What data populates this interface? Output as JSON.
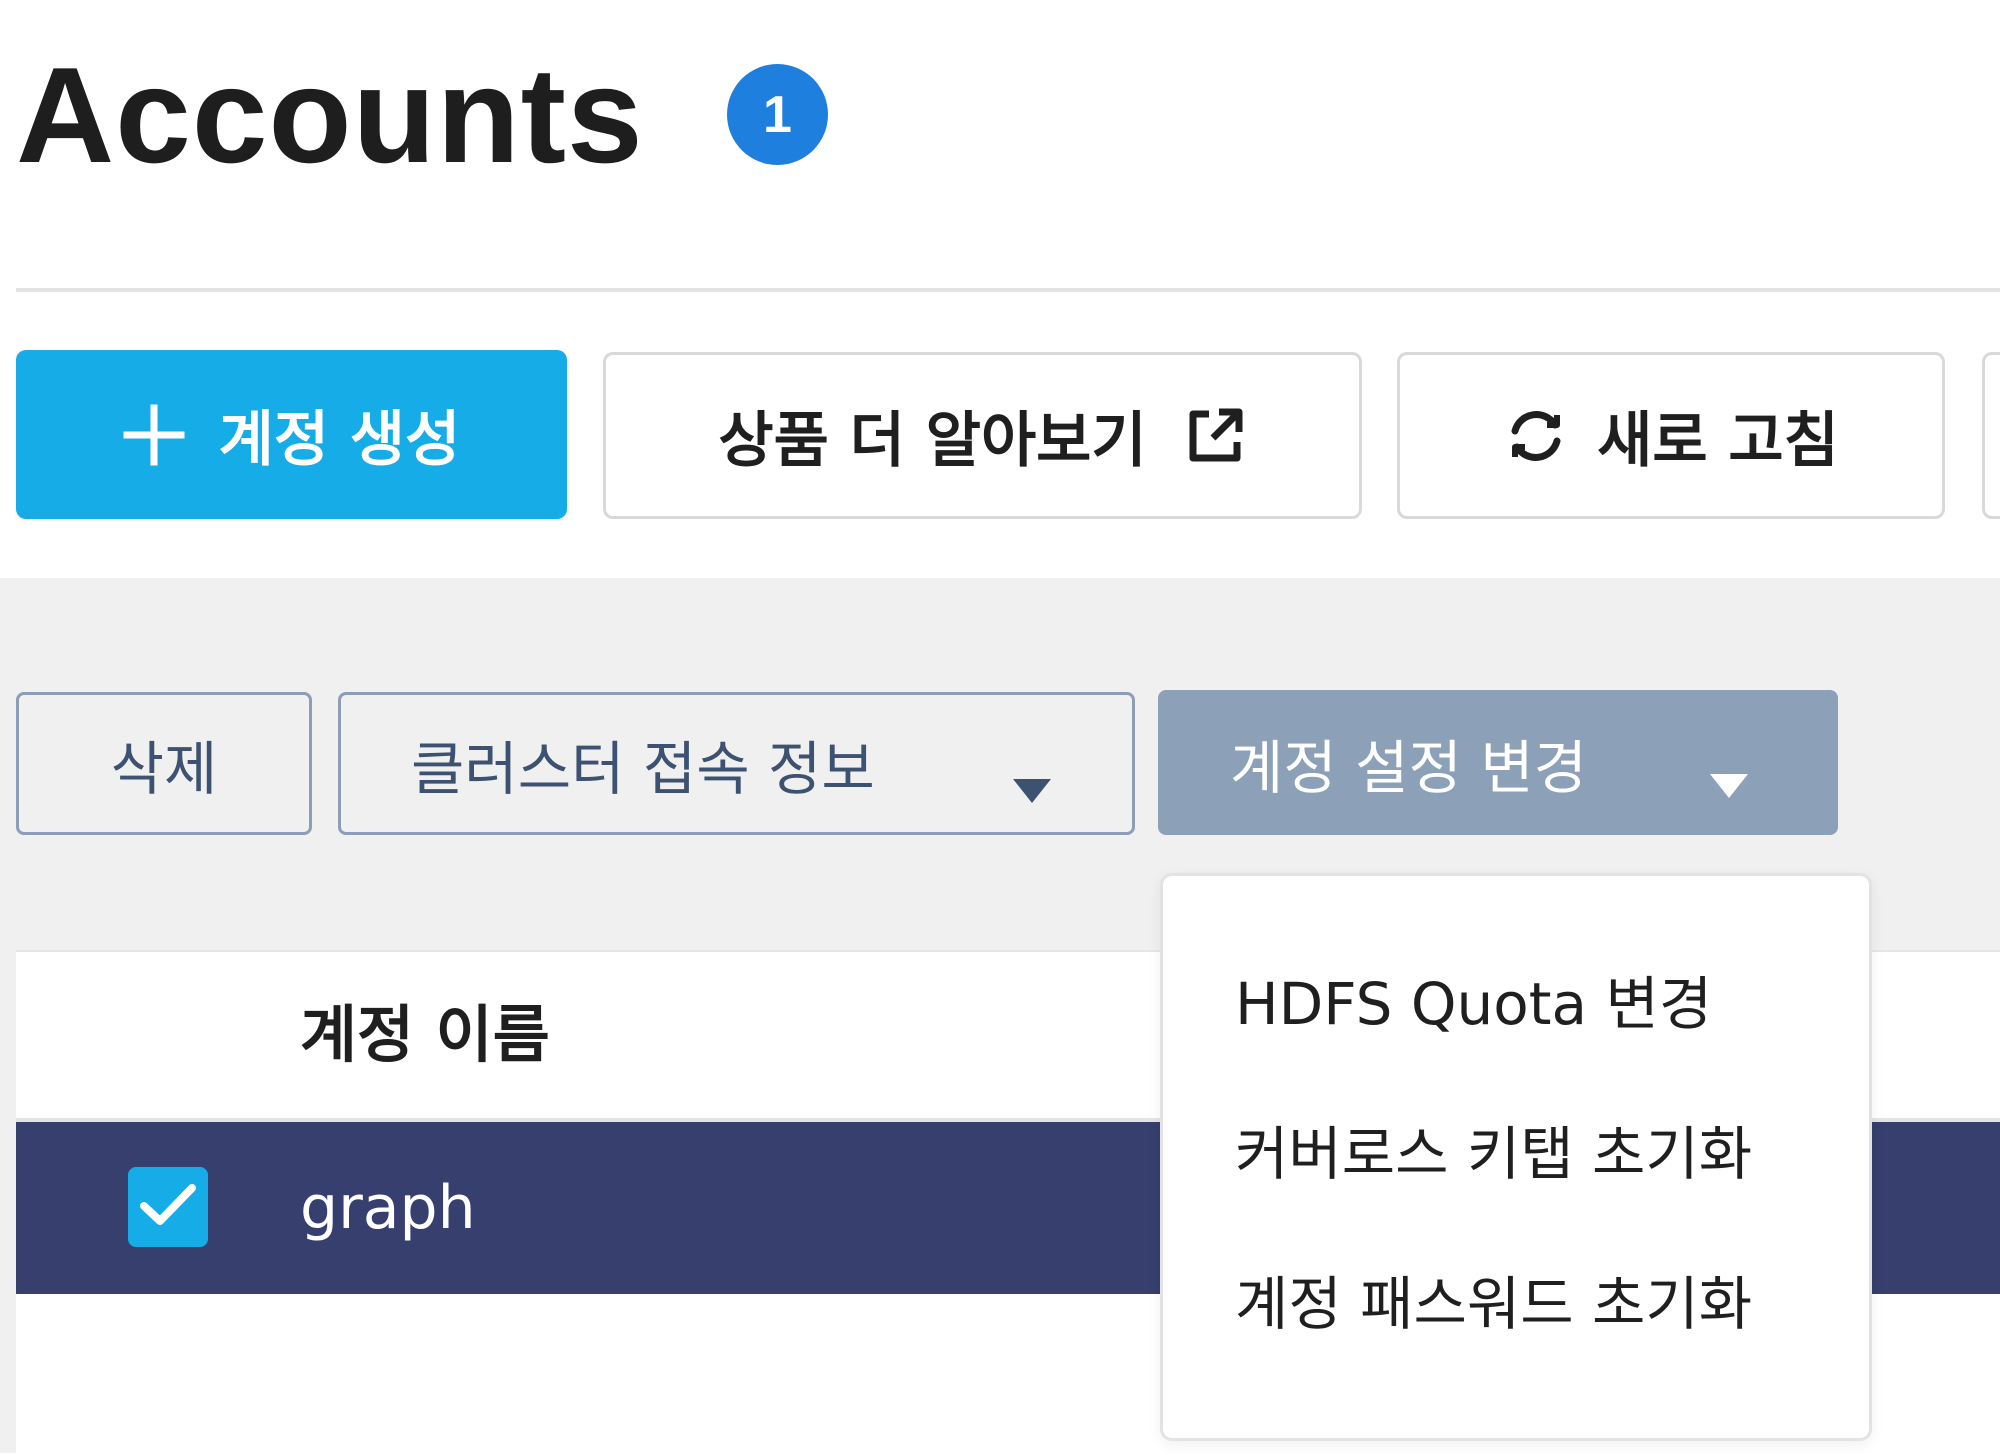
{
  "page": {
    "title": "Accounts",
    "count_badge": "1"
  },
  "toolbar": {
    "create_label": "계정 생성",
    "learn_more_label": "상품 더 알아보기",
    "refresh_label": "새로 고침"
  },
  "actions": {
    "delete_label": "삭제",
    "cluster_info_label": "클러스터 접속 정보",
    "account_settings_label": "계정 설정 변경"
  },
  "account_settings_menu": {
    "items": [
      {
        "label": "HDFS Quota 변경"
      },
      {
        "label": "커버로스 키탭 초기화"
      },
      {
        "label": "계정 패스워드 초기화"
      }
    ]
  },
  "table": {
    "columns": [
      {
        "label": "계정 이름"
      }
    ],
    "rows": [
      {
        "name": "graph",
        "selected": true
      }
    ]
  },
  "icons": {
    "create": "plus-icon",
    "learn_more": "external-link-icon",
    "refresh": "refresh-icon",
    "dropdown": "caret-down-icon",
    "row_check": "checkmark-icon"
  },
  "colors": {
    "primary": "#15ace8",
    "badge": "#1e7fde",
    "settings_button": "#8ca0b8",
    "selected_row": "#363f6d",
    "action_text": "#3d5170"
  }
}
